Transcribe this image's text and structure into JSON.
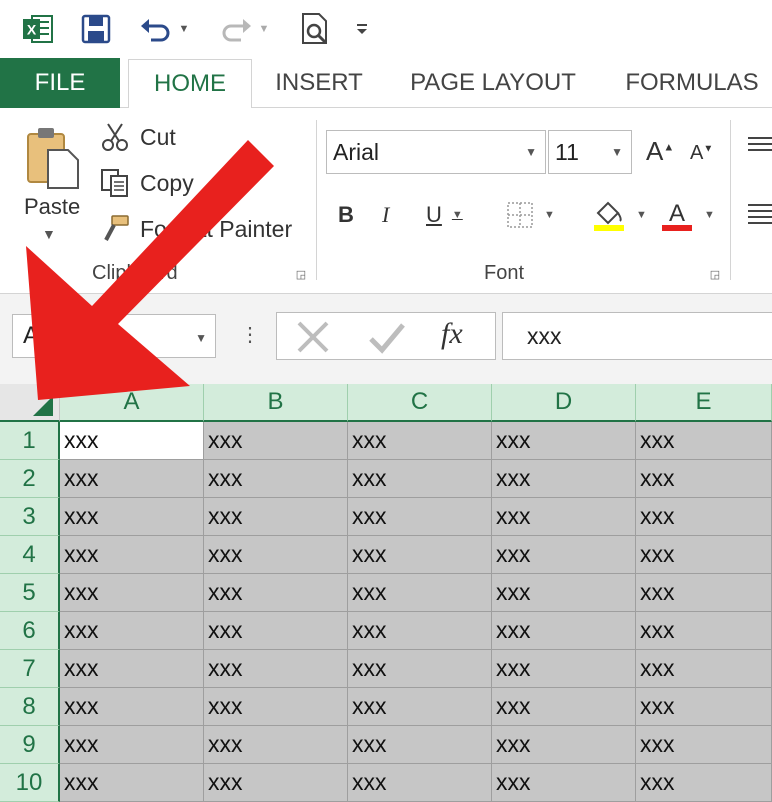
{
  "quick_access": {
    "icons": [
      "excel-logo-icon",
      "save-icon",
      "undo-icon",
      "redo-icon",
      "print-preview-icon",
      "customize-qat-icon"
    ]
  },
  "tabs": [
    {
      "id": "file",
      "label": "FILE"
    },
    {
      "id": "home",
      "label": "HOME",
      "active": true
    },
    {
      "id": "insert",
      "label": "INSERT"
    },
    {
      "id": "pagelayout",
      "label": "PAGE LAYOUT"
    },
    {
      "id": "formulas",
      "label": "FORMULAS"
    }
  ],
  "ribbon": {
    "clipboard": {
      "paste_label": "Paste",
      "cut_label": "Cut",
      "copy_label": "Copy",
      "format_painter_label": "Format Painter",
      "group_label": "Clipboard"
    },
    "font": {
      "font_name": "Arial",
      "font_size": "11",
      "bold_label": "B",
      "italic_label": "I",
      "underline_label": "U",
      "group_label": "Font"
    }
  },
  "formula_bar": {
    "name_box": "A1",
    "fx_label": "fx",
    "value": "xxx"
  },
  "grid": {
    "columns": [
      "A",
      "B",
      "C",
      "D",
      "E"
    ],
    "rows": [
      "1",
      "2",
      "3",
      "4",
      "5",
      "6",
      "7",
      "8",
      "9",
      "10"
    ],
    "cell_value": "xxx",
    "active_cell": "A1"
  },
  "colors": {
    "excel_green": "#217346",
    "header_selected": "#d3ecdb",
    "selection_gray": "#c6c6c6",
    "arrow_red": "#e8211e"
  }
}
